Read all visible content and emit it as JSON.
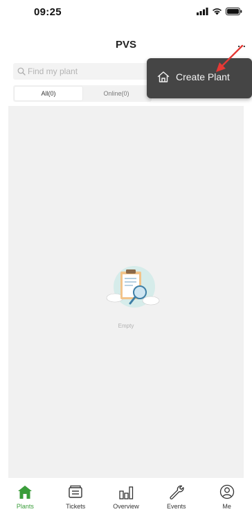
{
  "status_bar": {
    "time": "09:25"
  },
  "header": {
    "title": "PVS",
    "more_label": "..."
  },
  "search": {
    "placeholder": "Find my plant"
  },
  "tabs": [
    {
      "label": "All(0)",
      "active": true
    },
    {
      "label": "Online(0)",
      "active": false
    }
  ],
  "empty_state": {
    "text": "Empty"
  },
  "popup_menu": {
    "items": [
      {
        "label": "Create Plant",
        "icon": "home-outline-icon"
      }
    ]
  },
  "bottom_nav": {
    "items": [
      {
        "label": "Plants",
        "icon": "home-filled-icon",
        "active": true
      },
      {
        "label": "Tickets",
        "icon": "ticket-icon",
        "active": false
      },
      {
        "label": "Overview",
        "icon": "bar-chart-icon",
        "active": false
      },
      {
        "label": "Events",
        "icon": "wrench-icon",
        "active": false
      },
      {
        "label": "Me",
        "icon": "user-icon",
        "active": false
      }
    ]
  },
  "colors": {
    "accent": "#3a9d3a",
    "popup_bg": "#454545",
    "annotation_arrow": "#e53935",
    "content_bg": "#f1f1f1"
  }
}
